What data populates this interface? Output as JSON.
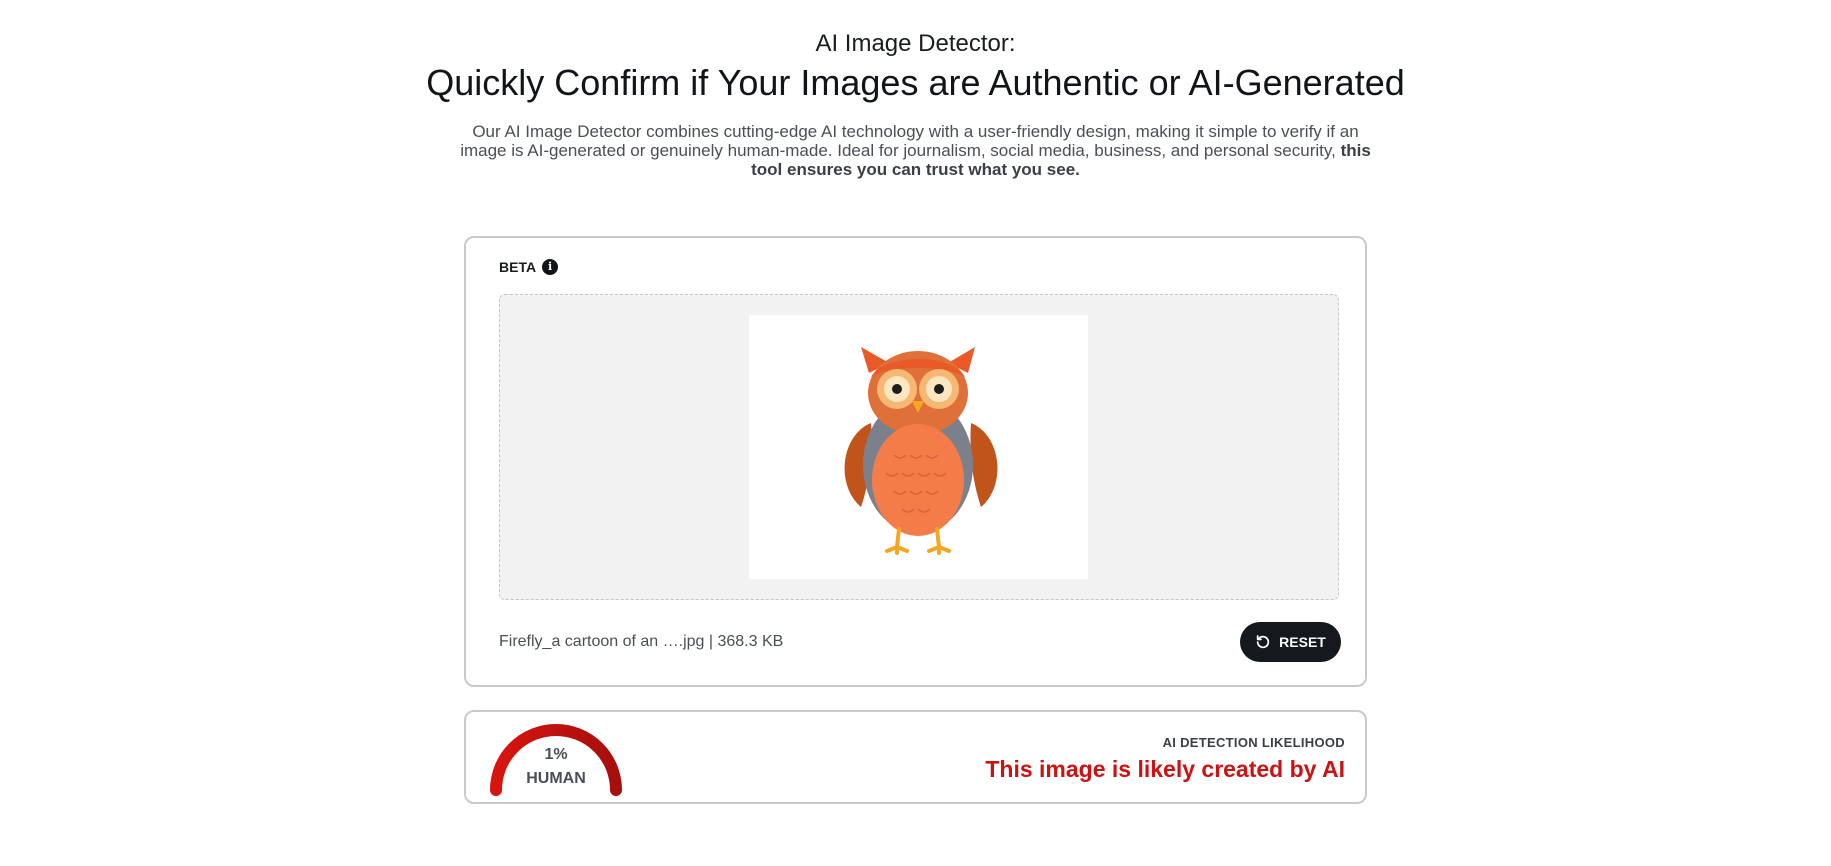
{
  "header": {
    "eyebrow": "AI Image Detector:",
    "headline": "Quickly Confirm if Your Images are Authentic or AI-Generated",
    "intro_plain": "Our AI Image Detector combines cutting-edge AI technology with a user-friendly design, making it simple to verify if an image is AI-generated or genuinely human-made. Ideal for journalism, social media, business, and personal security,",
    "intro_bold": "this tool ensures you can trust what you see."
  },
  "upload": {
    "badge": "BETA",
    "info_icon": "info-icon",
    "file_info": "Firefly_a cartoon of an ….jpg | 368.3 KB",
    "reset_label": "RESET",
    "reset_icon": "rotate-ccw-icon"
  },
  "result": {
    "gauge_value": "1%",
    "gauge_fraction": 0.01,
    "gauge_label": "HUMAN",
    "likelihood_label": "AI DETECTION LIKELIHOOD",
    "verdict": "This image is likely created by AI",
    "verdict_color": "#cc1212",
    "gauge_color": "#c0120f"
  }
}
